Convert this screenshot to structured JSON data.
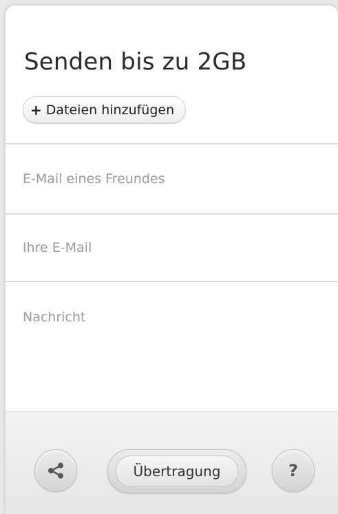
{
  "header": {
    "title": "Senden bis zu 2GB",
    "add_files_plus": "+",
    "add_files_label": "Dateien hinzufügen"
  },
  "form": {
    "friend_email_placeholder": "E-Mail eines Freundes",
    "own_email_placeholder": "Ihre E-Mail",
    "message_placeholder": "Nachricht"
  },
  "footer": {
    "share_icon": "share-icon",
    "transfer_label": "Übertragung",
    "help_label": "?"
  }
}
